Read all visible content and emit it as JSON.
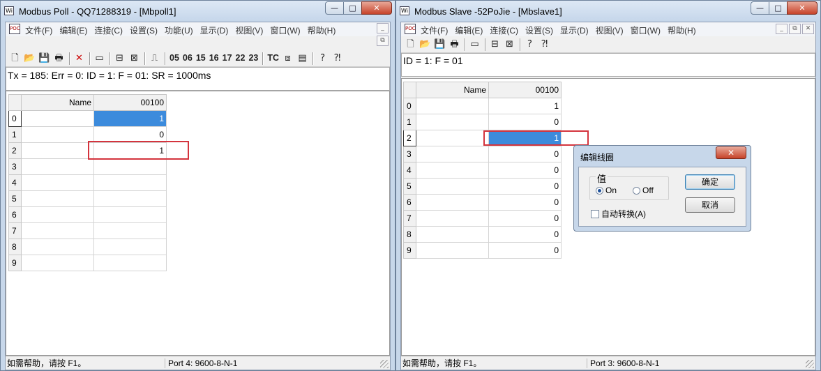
{
  "master": {
    "title": "Modbus Poll - QQ71288319 - [Mbpoll1]",
    "app_icon_text": "Wi",
    "window_buttons": {
      "minimize": "—",
      "maximize": "□",
      "close": "✕"
    },
    "menu": [
      "文件(F)",
      "编辑(E)",
      "连接(C)",
      "设置(S)",
      "功能(U)",
      "显示(D)",
      "视图(V)",
      "窗口(W)",
      "帮助(H)"
    ],
    "mdi_buttons": {
      "minimize": "_",
      "restore": "⧉"
    },
    "toolbar": {
      "new": "🗋",
      "open": "📂",
      "save": "💾",
      "print": "🖶",
      "delete": "✕",
      "window": "▭",
      "connect": "⊟",
      "disconnect": "⊠",
      "pulse": "⎍",
      "function_codes": [
        "05",
        "06",
        "15",
        "16",
        "17",
        "22",
        "23"
      ],
      "tc": "TC",
      "chart": "⧈",
      "monitor": "▤",
      "help": "?",
      "context_help": "⁈"
    },
    "info": "Tx = 185: Err = 0: ID = 1: F = 01: SR = 1000ms",
    "grid": {
      "header": {
        "name": "Name",
        "address": "00100"
      },
      "rows": [
        {
          "index": "0",
          "name": "",
          "value": "1"
        },
        {
          "index": "1",
          "name": "",
          "value": "0"
        },
        {
          "index": "2",
          "name": "",
          "value": "1"
        },
        {
          "index": "3",
          "name": "",
          "value": ""
        },
        {
          "index": "4",
          "name": "",
          "value": ""
        },
        {
          "index": "5",
          "name": "",
          "value": ""
        },
        {
          "index": "6",
          "name": "",
          "value": ""
        },
        {
          "index": "7",
          "name": "",
          "value": ""
        },
        {
          "index": "8",
          "name": "",
          "value": ""
        },
        {
          "index": "9",
          "name": "",
          "value": ""
        }
      ]
    },
    "status": {
      "help": "如需帮助，请按 F1。",
      "port": "Port 4: 9600-8-N-1"
    }
  },
  "slave": {
    "title": "Modbus Slave -52PoJie - [Mbslave1]",
    "app_icon_text": "Wi",
    "window_buttons": {
      "minimize": "—",
      "maximize": "□",
      "close": "✕"
    },
    "menu": [
      "文件(F)",
      "编辑(E)",
      "连接(C)",
      "设置(S)",
      "显示(D)",
      "视图(V)",
      "窗口(W)",
      "帮助(H)"
    ],
    "mdi_buttons": {
      "minimize": "_",
      "restore": "⧉",
      "close": "✕"
    },
    "toolbar": {
      "new": "🗋",
      "open": "📂",
      "save": "💾",
      "print": "🖶",
      "window": "▭",
      "connect": "⊟",
      "disconnect": "⊠",
      "help": "?",
      "context_help": "⁈"
    },
    "info": "ID = 1: F = 01",
    "grid": {
      "header": {
        "name": "Name",
        "address": "00100"
      },
      "rows": [
        {
          "index": "0",
          "name": "",
          "value": "1"
        },
        {
          "index": "1",
          "name": "",
          "value": "0"
        },
        {
          "index": "2",
          "name": "",
          "value": "1"
        },
        {
          "index": "3",
          "name": "",
          "value": "0"
        },
        {
          "index": "4",
          "name": "",
          "value": "0"
        },
        {
          "index": "5",
          "name": "",
          "value": "0"
        },
        {
          "index": "6",
          "name": "",
          "value": "0"
        },
        {
          "index": "7",
          "name": "",
          "value": "0"
        },
        {
          "index": "8",
          "name": "",
          "value": "0"
        },
        {
          "index": "9",
          "name": "",
          "value": "0"
        }
      ]
    },
    "status": {
      "help": "如需帮助，请按 F1。",
      "port": "Port 3: 9600-8-N-1"
    }
  },
  "dialog": {
    "title": "编辑线圈",
    "close": "✕",
    "group_label": "值",
    "on_label": "On",
    "off_label": "Off",
    "selected": "On",
    "auto_label": "自动转换(A)",
    "auto_checked": false,
    "ok_label": "确定",
    "cancel_label": "取消"
  },
  "colors": {
    "selection": "#3c8bdc",
    "highlight_box": "#d4343d"
  }
}
